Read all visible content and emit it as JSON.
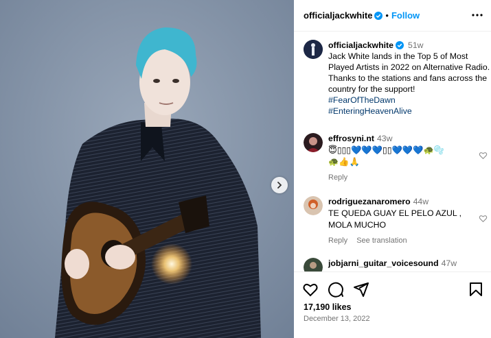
{
  "header": {
    "username": "officialjackwhite",
    "separator": "•",
    "follow_label": "Follow"
  },
  "caption": {
    "username": "officialjackwhite",
    "time": "51w",
    "text": "Jack White lands in the Top 5 of Most Played Artists in 2022 on Alternative Radio. Thanks to the stations and fans across the country for the support!",
    "hashtags": [
      "#FearOfTheDawn",
      "#EnteringHeavenAlive"
    ]
  },
  "comments": [
    {
      "username": "effrosyni.nt",
      "time": "43w",
      "text_line1": "😇▯▯▯💙💙💙▯▯💙💙💙🐢🫧",
      "text_line2": "🐢👍🙏",
      "reply_label": "Reply"
    },
    {
      "username": "rodriguezanaromero",
      "time": "44w",
      "text_line1": "TE QUEDA GUAY EL PELO AZUL ,",
      "text_line2": "MOLA MUCHO",
      "reply_label": "Reply",
      "translate_label": "See translation"
    },
    {
      "username": "jobjarni_guitar_voicesound",
      "time": "47w"
    }
  ],
  "footer": {
    "likes": "17,190 likes",
    "date": "December 13, 2022"
  },
  "colors": {
    "accent": "#0095f6",
    "hashtag": "#00376b",
    "muted": "#737373",
    "hair": "#3fb6cf"
  },
  "icons": [
    "verified-badge-icon",
    "more-options-icon",
    "next-arrow-icon",
    "heart-icon",
    "comment-icon",
    "share-icon",
    "bookmark-icon"
  ]
}
